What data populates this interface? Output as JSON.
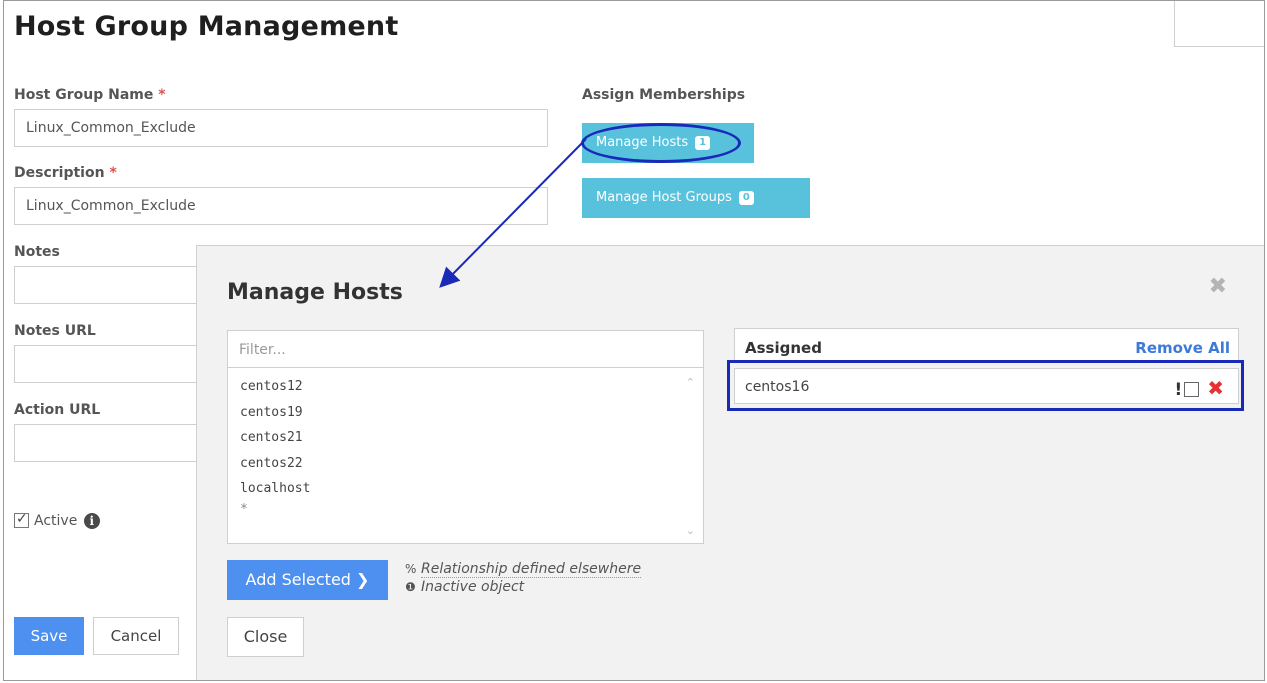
{
  "page": {
    "title": "Host Group Management"
  },
  "form": {
    "host_group_name_label": "Host Group Name",
    "host_group_name_value": "Linux_Common_Exclude",
    "description_label": "Description",
    "description_value": "Linux_Common_Exclude",
    "required_mark": "*",
    "notes_label": "Notes",
    "notes_url_label": "Notes URL",
    "action_url_label": "Action URL",
    "active_label": "Active",
    "active_checked": true,
    "info_icon_glyph": "i",
    "save_label": "Save",
    "cancel_label": "Cancel"
  },
  "memberships": {
    "label": "Assign Memberships",
    "manage_hosts_label": "Manage Hosts",
    "manage_hosts_count": "1",
    "manage_host_groups_label": "Manage Host Groups",
    "manage_host_groups_count": "0"
  },
  "modal": {
    "title": "Manage Hosts",
    "close_glyph": "✖",
    "filter_placeholder": "Filter...",
    "available_hosts": [
      "centos12",
      "centos19",
      "centos21",
      "centos22",
      "localhost",
      "*"
    ],
    "add_selected_label": "Add Selected ❯",
    "legend_relationship": "Relationship defined elsewhere",
    "legend_inactive": "Inactive object",
    "legend_relationship_icon": "%",
    "legend_inactive_icon": "❶",
    "close_label": "Close",
    "assigned_header": "Assigned",
    "remove_all_label": "Remove All",
    "assigned_hosts": [
      {
        "name": "centos16",
        "flag": "!",
        "remove": "✖"
      }
    ]
  },
  "colors": {
    "info_button": "#58c2dd",
    "primary_button": "#4d90ef",
    "annotation": "#1a2ab8",
    "remove_x": "#e53333",
    "link": "#3b7ad9"
  }
}
